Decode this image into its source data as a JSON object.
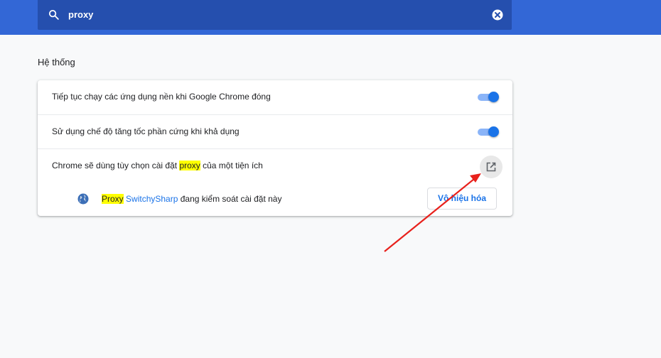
{
  "search": {
    "query": "proxy"
  },
  "section": {
    "title": "Hệ thống"
  },
  "settings": {
    "rows": [
      {
        "label": "Tiếp tục chạy các ứng dụng nền khi Google Chrome đóng",
        "toggle": true
      },
      {
        "label": "Sử dụng chế độ tăng tốc phần cứng khi khả dụng",
        "toggle": true
      }
    ],
    "proxy_row": {
      "label_before": "Chrome sẽ dùng tùy chọn cài đặt ",
      "label_highlight": "proxy",
      "label_after": " của một tiện ích"
    },
    "extension_row": {
      "highlight": "Proxy",
      "extension_name": " SwitchySharp",
      "suffix": " đang kiểm soát cài đặt này",
      "disable_button": "Vô hiệu hóa"
    }
  },
  "colors": {
    "header": "#3367d6",
    "search_box": "#254fae",
    "accent": "#1a73e8",
    "highlight": "#ffff00",
    "annotation_arrow": "#e8211c"
  },
  "icons": [
    "search-icon",
    "clear-icon",
    "open-in-new-icon",
    "globe-icon"
  ]
}
